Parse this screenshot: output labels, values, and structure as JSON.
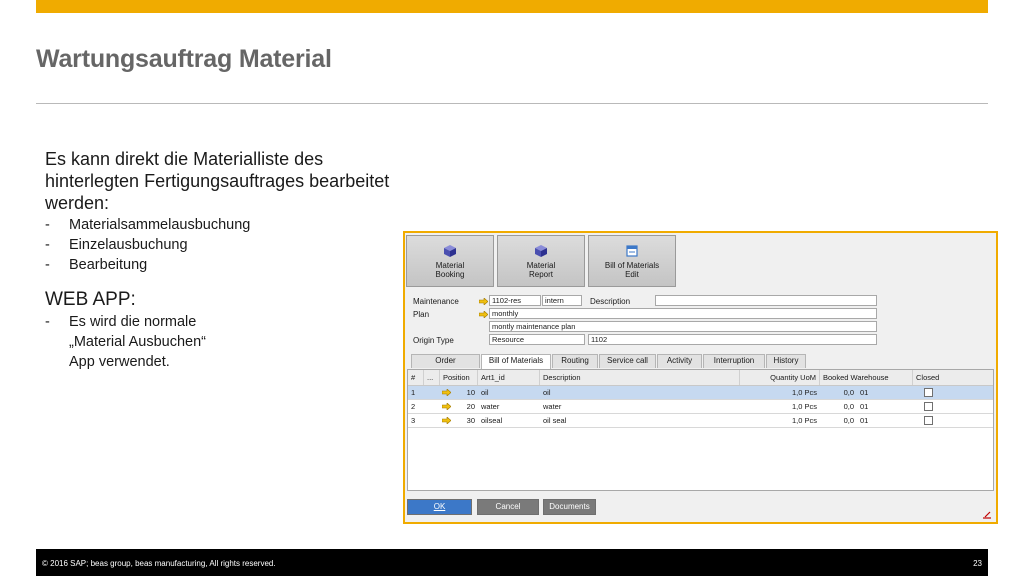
{
  "slide": {
    "title": "Wartungsauftrag Material",
    "intro": "Es kann direkt die Materialliste des hinterlegten Fertigungsauftrages bearbeitet werden:",
    "bullets": [
      "Materialsammelausbuchung",
      "Einzelausbuchung",
      "Bearbeitung"
    ],
    "webapp_heading": "WEB APP:",
    "webapp_bullet_lines": [
      "Es wird die normale",
      "„Material Ausbuchen“",
      "App verwendet."
    ],
    "footer_text": "©  2016 SAP; beas group, beas manufacturing,  All rights reserved.",
    "page_number": "23",
    "accent_color": "#f0ab00"
  },
  "app": {
    "toolbar": [
      {
        "label": "Material\nBooking",
        "icon": "cube-icon"
      },
      {
        "label": "Material\nReport",
        "icon": "cube-icon"
      },
      {
        "label": "Bill of Materials\nEdit",
        "icon": "edit-document-icon"
      }
    ],
    "form": {
      "maintenance_label": "Maintenance",
      "maintenance_value": "1102-res",
      "maintenance_code": "intern",
      "description_label": "Description",
      "description_value": "",
      "plan_label": "Plan",
      "plan_value": "monthly",
      "plan_description": "montly maintenance plan",
      "origin_type_label": "Origin Type",
      "origin_type_value": "Resource",
      "origin_value": "1102"
    },
    "tabs": [
      "Order",
      "Bill of Materials",
      "Routing",
      "Service call",
      "Activity",
      "Interruption",
      "History"
    ],
    "active_tab": "Bill of Materials",
    "grid": {
      "headers": [
        "#",
        "...",
        "Position",
        "Art1_id",
        "Description",
        "Quantity UoM",
        "Booked Warehouse",
        "Closed"
      ],
      "rows": [
        {
          "num": "1",
          "position": "10",
          "art": "oil",
          "description": "oil",
          "qty": "1,0 Pcs",
          "booked": "0,0",
          "warehouse": "01",
          "closed": false
        },
        {
          "num": "2",
          "position": "20",
          "art": "water",
          "description": "water",
          "qty": "1,0 Pcs",
          "booked": "0,0",
          "warehouse": "01",
          "closed": false
        },
        {
          "num": "3",
          "position": "30",
          "art": "oilseal",
          "description": "oil seal",
          "qty": "1,0 Pcs",
          "booked": "0,0",
          "warehouse": "01",
          "closed": false
        }
      ],
      "selected_row": 1
    },
    "buttons": {
      "ok": "OK",
      "cancel": "Cancel",
      "documents": "Documents"
    }
  }
}
